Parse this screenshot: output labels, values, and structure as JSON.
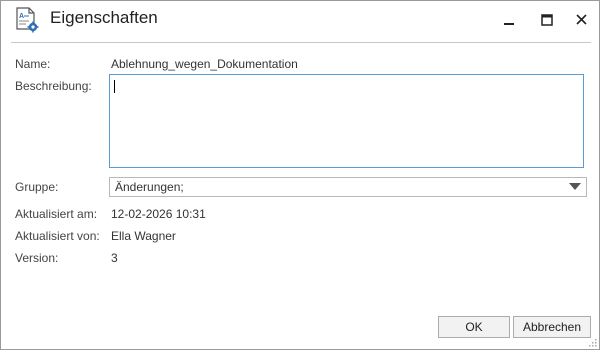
{
  "window": {
    "title": "Eigenschaften",
    "title_icon": "document-properties-icon"
  },
  "fields": {
    "name_label": "Name:",
    "name_value": "Ablehnung_wegen_Dokumentation",
    "description_label": "Beschreibung:",
    "description_value": "",
    "group_label": "Gruppe:",
    "group_value": "Änderungen;",
    "updated_at_label": "Aktualisiert am:",
    "updated_at_value": "12-02-2026 10:31",
    "updated_by_label": "Aktualisiert von:",
    "updated_by_value": "Ella Wagner",
    "version_label": "Version:",
    "version_value": "3"
  },
  "buttons": {
    "ok": "OK",
    "cancel": "Abbrechen"
  },
  "colors": {
    "focus_border": "#5a9bd5",
    "icon_accent": "#2f6fb6"
  }
}
